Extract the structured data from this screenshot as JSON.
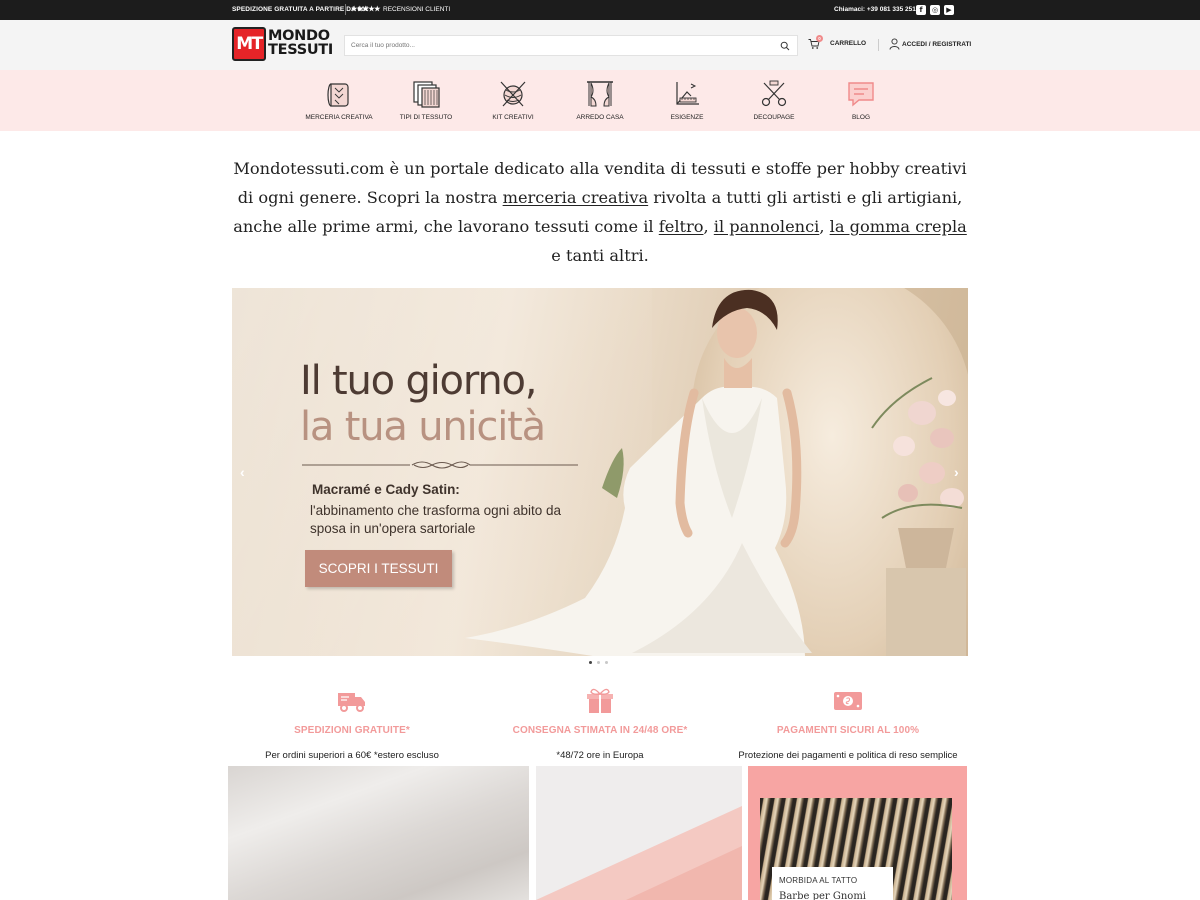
{
  "topbar": {
    "promo": "SPEDIZIONE GRATUITA A PARTIRE DA 60€",
    "stars": "★★★★★",
    "reviews": "RECENSIONI CLIENTI",
    "phone": "Chiamaci: +39 081 335 2512",
    "social": [
      {
        "icon": "facebook-icon",
        "glyph": "f"
      },
      {
        "icon": "instagram-icon",
        "glyph": "◎"
      },
      {
        "icon": "youtube-icon",
        "glyph": "▶"
      }
    ]
  },
  "header": {
    "logo": {
      "badge": "MT",
      "word1": "MONDO",
      "word2": "TESSUTI"
    },
    "search": {
      "placeholder": "Cerca il tuo prodotto..."
    },
    "cart": {
      "label": "CARRELLO",
      "count": "0"
    },
    "account": {
      "label": "ACCEDI / REGISTRATI"
    }
  },
  "categories": [
    {
      "label": "MERCERIA CREATIVA",
      "icon": "fabric-roll-icon"
    },
    {
      "label": "TIPI DI TESSUTO",
      "icon": "fabric-layers-icon"
    },
    {
      "label": "KIT CREATIVI",
      "icon": "yarn-ball-icon"
    },
    {
      "label": "ARREDO CASA",
      "icon": "curtain-icon"
    },
    {
      "label": "ESIGENZE",
      "icon": "measure-icon"
    },
    {
      "label": "DECOUPAGE",
      "icon": "scissors-icon"
    },
    {
      "label": "BLOG",
      "icon": "chat-icon"
    }
  ],
  "intro": {
    "p1": "Mondotessuti.com è un portale dedicato alla vendita di tessuti e stoffe per hobby creativi di ogni genere. Scopri la nostra ",
    "link1": "merceria creativa",
    "p2": " rivolta a tutti gli artisti e gli artigiani, anche alle prime armi, che lavorano tessuti come il ",
    "link2": "feltro",
    "sep1": ", ",
    "link3": "il pannolenci",
    "sep2": ", ",
    "link4": "la gomma crepla",
    "p3": " e tanti altri."
  },
  "hero": {
    "title_line1": "Il tuo giorno,",
    "title_line2": "la tua unicità",
    "subtitle_bold": "Macramé e Cady Satin:",
    "subtitle": "l'abbinamento che trasforma ogni abito da sposa in un'opera sartoriale",
    "cta": "SCOPRI I TESSUTI",
    "prev": "‹",
    "next": "›",
    "slides": 3,
    "active_slide": 1
  },
  "features": [
    {
      "icon": "delivery-truck-icon",
      "title": "SPEDIZIONI GRATUITE*",
      "desc": "Per ordini superiori a 60€ *estero escluso"
    },
    {
      "icon": "gift-box-icon",
      "title": "CONSEGNA STIMATA IN 24/48 ORE*",
      "desc": "*48/72 ore in Europa"
    },
    {
      "icon": "money-shield-icon",
      "title": "PAGAMENTI SICURI AL 100%",
      "desc": "Protezione dei pagamenti e politica di reso semplice"
    }
  ],
  "tiles": {
    "tile3_kicker": "MORBIDA AL TATTO",
    "tile3_name": "Barbe per Gnomi"
  },
  "colors": {
    "topbar": "#1c1c1c",
    "header_bg": "#f4f4f4",
    "catnav_bg": "#fde9e8",
    "accent_pink": "#f29a9a",
    "cta": "#c18b7b",
    "logo_red": "#e52428"
  }
}
